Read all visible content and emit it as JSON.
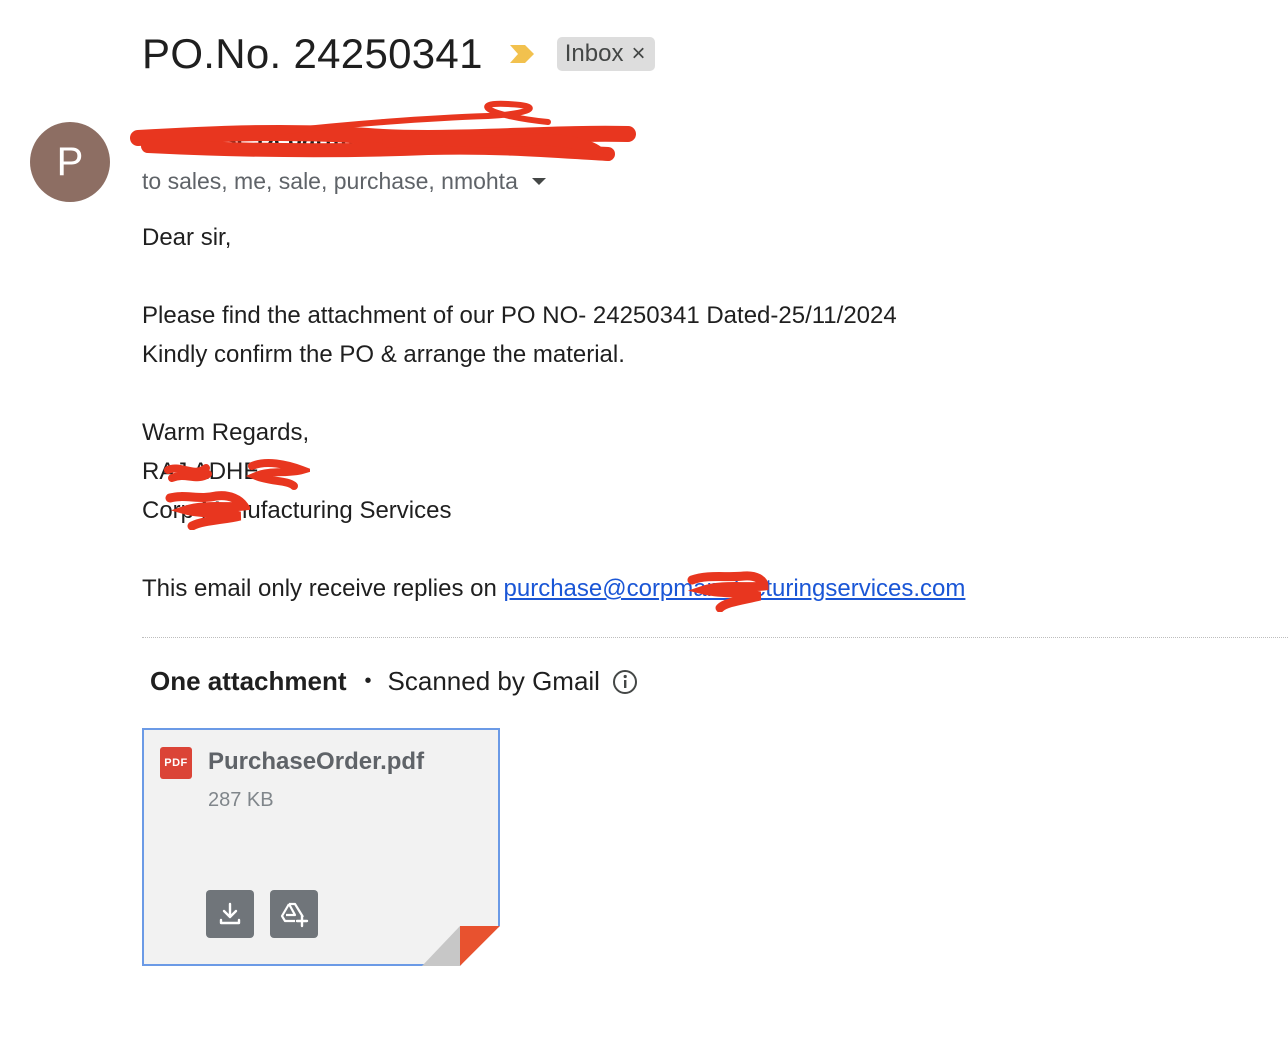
{
  "email": {
    "subject": "PO.No. 24250341",
    "label_chip": "Inbox",
    "label_close": "×",
    "avatar_letter": "P",
    "sender_name": "Purchase Department",
    "recipients": "to sales, me, sale, purchase, nmohta",
    "body": {
      "greeting": "Dear sir,",
      "line1": "Please find the attachment of our PO NO- 24250341 Dated-25/11/2024",
      "line2": "Kindly confirm the PO & arrange the material.",
      "closing": "Warm Regards,",
      "signature_name": "RAJ ADHE",
      "signature_company": "Corp Manufacturing Services",
      "reply_note": "This email only receive replies on",
      "reply_email": "purchase@corpmanufacturingservices.com"
    }
  },
  "attachments": {
    "count_label": "One attachment",
    "separator": "•",
    "scan_label": "Scanned by Gmail",
    "items": [
      {
        "file_type": "PDF",
        "name": "PurchaseOrder.pdf",
        "size": "287 KB"
      }
    ]
  },
  "icons": {
    "importance": "importance-marker-icon",
    "info": "info-icon",
    "download": "download-icon",
    "drive": "add-to-drive-icon",
    "caret": "chevron-down-icon"
  },
  "colors": {
    "avatar": "#8d6e63",
    "importance": "#f2c14e",
    "link": "#1a56d6",
    "pdf_badge": "#db4437",
    "card_border": "#6b9ae6",
    "redaction": "#e8361f"
  }
}
